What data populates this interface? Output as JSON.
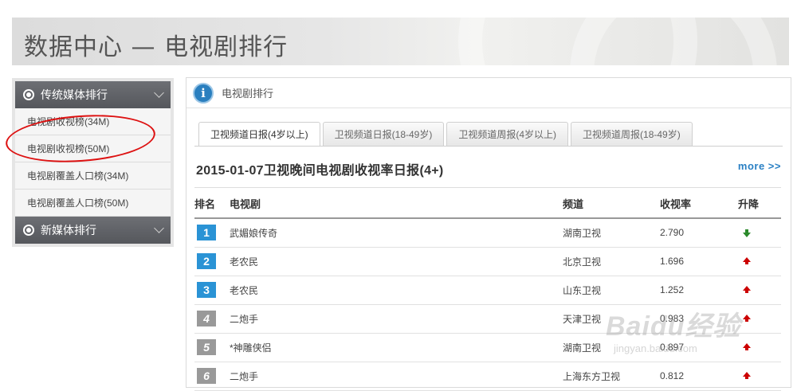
{
  "banner": {
    "title": "数据中心 — 电视剧排行"
  },
  "sidebar": {
    "section1": "传统媒体排行",
    "items": [
      "电视剧收视榜(34M)",
      "电视剧收视榜(50M)",
      "电视剧覆盖人口榜(34M)",
      "电视剧覆盖人口榜(50M)"
    ],
    "section2": "新媒体排行"
  },
  "main": {
    "header_title": "电视剧排行",
    "tabs": [
      "卫视频道日报(4岁以上)",
      "卫视频道日报(18-49岁)",
      "卫视频道周报(4岁以上)",
      "卫视频道周报(18-49岁)"
    ],
    "active_tab": 0,
    "report_title": "2015-01-07卫视晚间电视剧收视率日报(4+)",
    "more": "more >>",
    "columns": [
      "排名",
      "电视剧",
      "频道",
      "收视率",
      "升降"
    ],
    "rows": [
      {
        "rank": "1",
        "drama": "武媚娘传奇",
        "channel": "湖南卫视",
        "rating": "2.790",
        "trend": "down"
      },
      {
        "rank": "2",
        "drama": "老农民",
        "channel": "北京卫视",
        "rating": "1.696",
        "trend": "up"
      },
      {
        "rank": "3",
        "drama": "老农民",
        "channel": "山东卫视",
        "rating": "1.252",
        "trend": "up"
      },
      {
        "rank": "4",
        "drama": "二炮手",
        "channel": "天津卫视",
        "rating": "0.983",
        "trend": "up"
      },
      {
        "rank": "5",
        "drama": "*神雕侠侣",
        "channel": "湖南卫视",
        "rating": "0.897",
        "trend": "up"
      },
      {
        "rank": "6",
        "drama": "二炮手",
        "channel": "上海东方卫视",
        "rating": "0.812",
        "trend": "up"
      }
    ]
  },
  "watermark": {
    "logo": "Baidu经验",
    "url": "jingyan.baidu.com"
  },
  "colors": {
    "rank_top": "#2a93d5",
    "rank_rest": "#999999",
    "up": "#cc0000",
    "down": "#2b8a2b",
    "more": "#2a80c4"
  }
}
